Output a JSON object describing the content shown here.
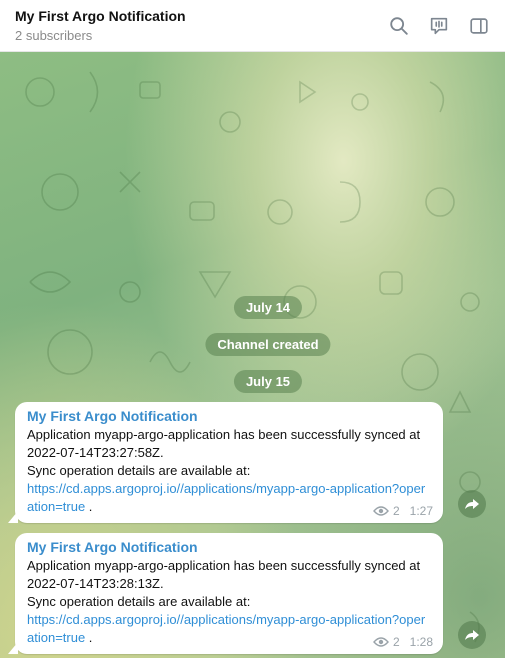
{
  "header": {
    "title": "My First Argo Notification",
    "subtitle": "2 subscribers",
    "icons": [
      "search-icon",
      "live-chat-icon",
      "sidebar-toggle-icon"
    ]
  },
  "dates": {
    "first": "July 14",
    "channel_created": "Channel created",
    "second": "July 15"
  },
  "messages": [
    {
      "sender": "My First Argo Notification",
      "line1": "Application myapp-argo-application has been successfully synced at",
      "line2": "2022-07-14T23:27:58Z.",
      "line3": "Sync operation details are available at:",
      "link": "https://cd.apps.argoproj.io//applications/myapp-argo-application?operation=true",
      "link_suffix": " .",
      "views": "2",
      "time": "1:27"
    },
    {
      "sender": "My First Argo Notification",
      "line1": "Application myapp-argo-application has been successfully synced at",
      "line2": "2022-07-14T23:28:13Z.",
      "line3": "Sync operation details are available at:",
      "link": "https://cd.apps.argoproj.io//applications/myapp-argo-application?operation=true",
      "link_suffix": " .",
      "views": "2",
      "time": "1:28"
    }
  ],
  "colors": {
    "accent": "#3a8dcc",
    "link": "#2f8ed6",
    "meta": "#9aa3a9",
    "pill_bg": "#5a8250"
  }
}
